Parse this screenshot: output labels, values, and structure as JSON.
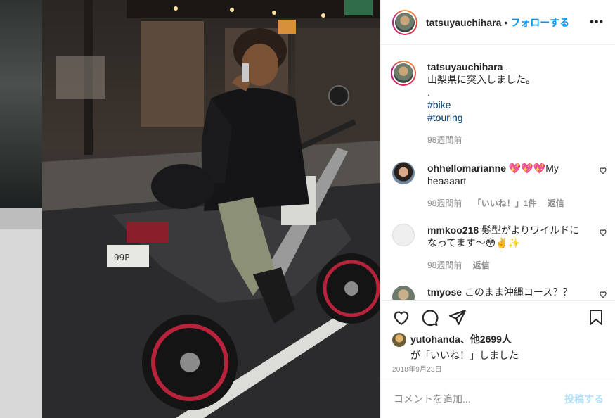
{
  "header": {
    "username": "tatsuyauchihara",
    "separator": "•",
    "follow_label": "フォローする",
    "more_label": "•••"
  },
  "caption": {
    "username": "tatsuyauchihara",
    "suffix": ".",
    "line1": "山梨県に突入しました。",
    "line2": ".",
    "hashtag1": "#bike",
    "hashtag2": "#touring",
    "time": "98週間前"
  },
  "comments": [
    {
      "username": "ohhellomarianne",
      "text": "💖💖💖My heaaaart",
      "time": "98週間前",
      "likes": "「いいね！」1件",
      "reply": "返信"
    },
    {
      "username": "mmkoo218",
      "text": "髪型がよりワイルドになってます〜😳✌️✨",
      "time": "98週間前",
      "reply": "返信"
    },
    {
      "username": "tmyose",
      "text": "このまま沖縄コース？？"
    }
  ],
  "likes": {
    "username": "yutohanda",
    "others": "、他2699人",
    "suffix": "が「いいね！」しました"
  },
  "date": "2018年9月23日",
  "comment_box": {
    "placeholder": "コメントを追加...",
    "post_label": "投稿する"
  },
  "colors": {
    "follow": "#0095f6",
    "post_disabled": "#b2dffc",
    "hashtag": "#00376b",
    "muted": "#8e8e8e"
  }
}
